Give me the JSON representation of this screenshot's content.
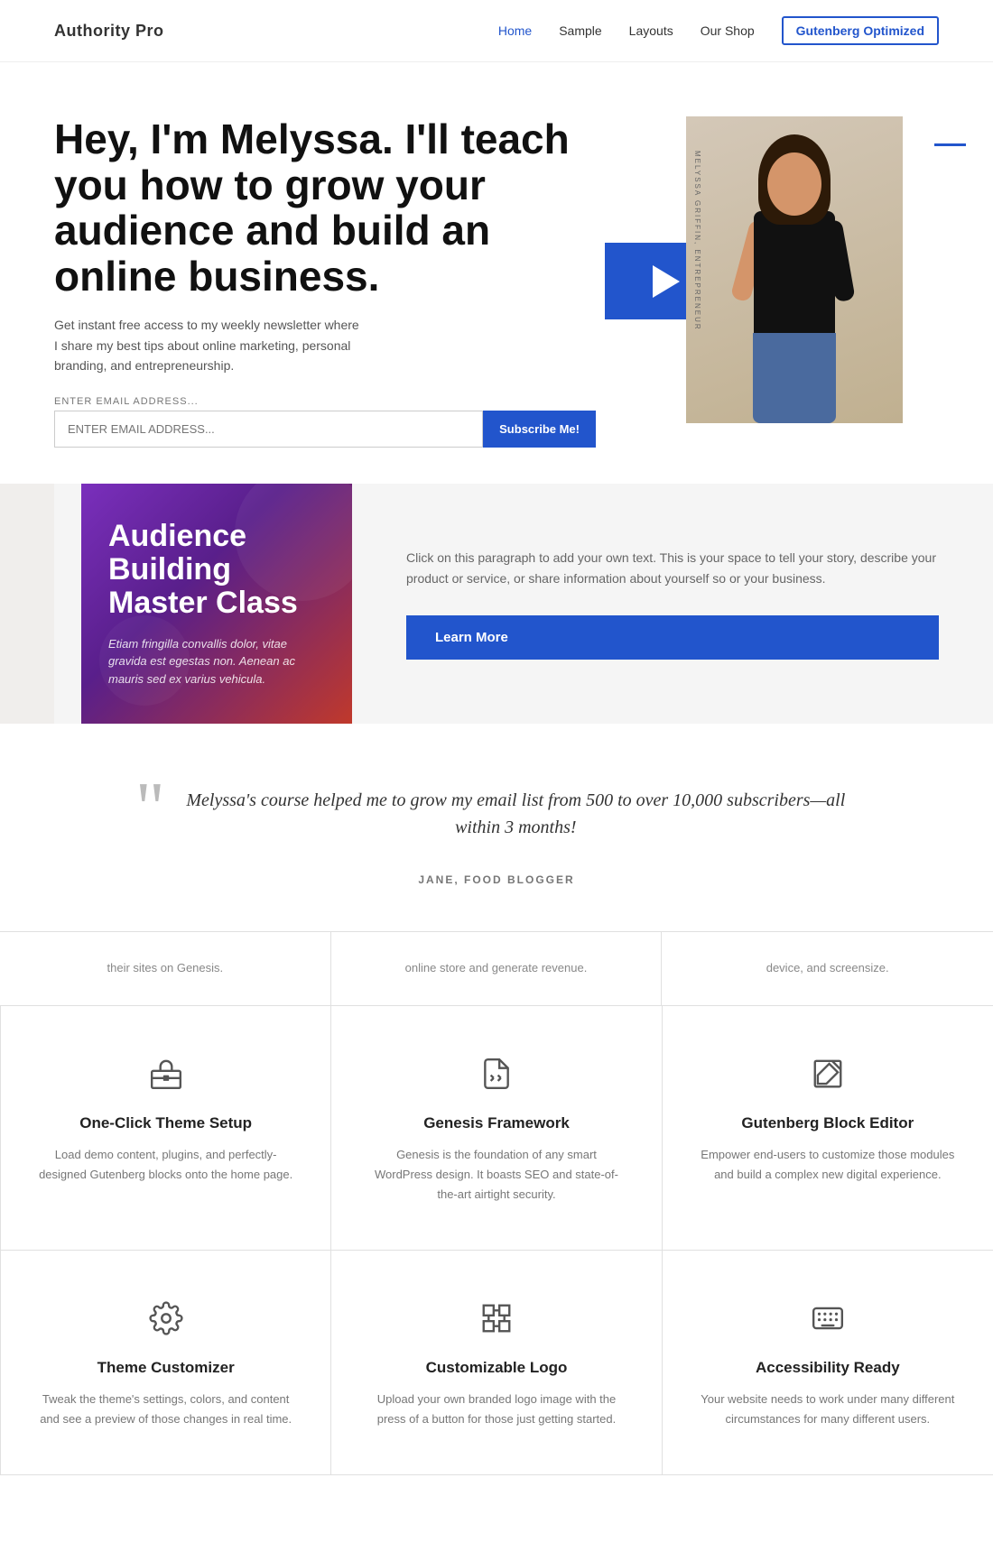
{
  "nav": {
    "logo": "Authority Pro",
    "links": [
      {
        "label": "Home",
        "active": true
      },
      {
        "label": "Sample",
        "active": false
      },
      {
        "label": "Layouts",
        "active": false
      },
      {
        "label": "Our Shop",
        "active": false
      },
      {
        "label": "Gutenberg Optimized",
        "active": false,
        "outline": true
      }
    ]
  },
  "hero": {
    "title": "Hey, I'm Melyssa. I'll teach you how to grow your audience and build an online business.",
    "description": "Get instant free access to my weekly newsletter where I share my best tips about online marketing, personal branding, and entrepreneurship.",
    "form": {
      "email_placeholder": "ENTER EMAIL ADDRESS...",
      "subscribe_label": "Subscribe Me!"
    },
    "photo_label": "MELYSSA GRIFFIN, ENTREPRENEUR"
  },
  "featured": {
    "card_title": "Audience Building Master Class",
    "card_body": "Etiam fringilla convallis dolor, vitae gravida est egestas non. Aenean ac mauris sed ex varius vehicula.",
    "content_text": "Click on this paragraph to add your own text. This is your space to tell your story, describe your product or service, or share information about yourself so or your business.",
    "learn_more": "Learn More"
  },
  "testimonial": {
    "quote": "Melyssa's course helped me to grow my email list from 500 to over 10,000 subscribers—all within 3 months!",
    "author": "JANE, FOOD BLOGGER"
  },
  "features_intro": [
    {
      "text": "their sites on Genesis."
    },
    {
      "text": "online store and generate revenue."
    },
    {
      "text": "device, and screensize."
    }
  ],
  "features": [
    {
      "icon": "toolbox",
      "title": "One-Click Theme Setup",
      "description": "Load demo content, plugins, and perfectly-designed Gutenberg blocks onto the home page."
    },
    {
      "icon": "code-file",
      "title": "Genesis Framework",
      "description": "Genesis is the foundation of any smart WordPress design. It boasts SEO and state-of-the-art airtight security."
    },
    {
      "icon": "edit-block",
      "title": "Gutenberg Block Editor",
      "description": "Empower end-users to customize those modules and build a complex new digital experience."
    },
    {
      "icon": "gear",
      "title": "Theme Customizer",
      "description": "Tweak the theme's settings, colors, and content and see a preview of those changes in real time."
    },
    {
      "icon": "logo-frame",
      "title": "Customizable Logo",
      "description": "Upload your own branded logo image with the press of a button for those just getting started."
    },
    {
      "icon": "keyboard",
      "title": "Accessibility Ready",
      "description": "Your website needs to work under many different circumstances for many different users."
    }
  ]
}
